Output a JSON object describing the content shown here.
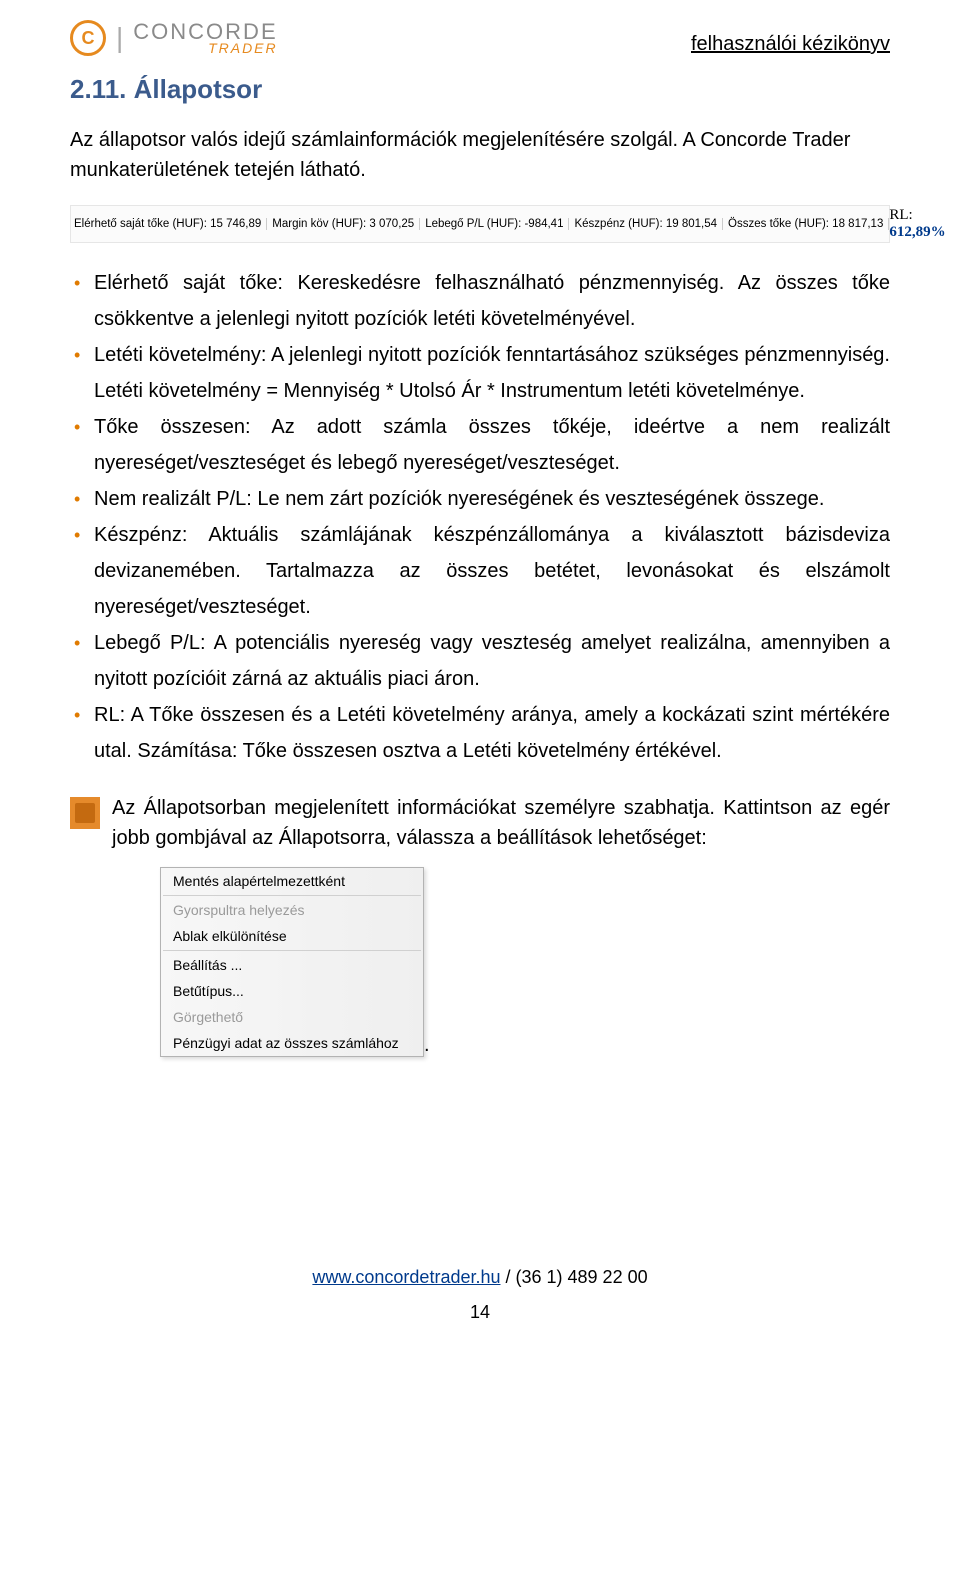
{
  "header": {
    "logo_letter": "C",
    "logo_main": "CONCORDE",
    "logo_sub": "TRADER",
    "right": "felhasználói kézikönyv"
  },
  "section_title": "2.11. Állapotsor",
  "intro": "Az állapotsor valós idejű számlainformációk megjelenítésére szolgál. A Concorde Trader munkaterületének tetején látható.",
  "statusbar": {
    "items": [
      "Elérhető saját tőke (HUF): 15 746,89",
      "Margin köv (HUF): 3 070,25",
      "Lebegő P/L (HUF): -984,41",
      "Készpénz (HUF): 19 801,54",
      "Összes tőke (HUF): 18 817,13"
    ],
    "rl_label": "RL: ",
    "rl_value": "612,89%"
  },
  "bullets": [
    "Elérhető saját tőke: Kereskedésre felhasználható pénzmennyiség. Az összes tőke csökkentve a jelenlegi nyitott pozíciók letéti követelményével.",
    "Letéti követelmény: A jelenlegi nyitott pozíciók fenntartásához szükséges pénzmennyiség. Letéti követelmény = Mennyiség * Utolsó Ár * Instrumentum letéti követelménye.",
    "Tőke összesen: Az adott számla összes tőkéje, ideértve a nem realizált nyereséget/veszteséget és lebegő nyereséget/veszteséget.",
    "Nem realizált P/L: Le nem zárt pozíciók nyereségének és veszteségének összege.",
    "Készpénz: Aktuális számlájának készpénzállománya a kiválasztott bázisdeviza devizanemében. Tartalmazza az összes betétet, levonásokat és elszámolt nyereséget/veszteséget.",
    "Lebegő P/L: A potenciális nyereség vagy veszteség amelyet realizálna, amennyiben a nyitott pozícióit zárná az aktuális piaci áron.",
    "RL: A Tőke összesen és a Letéti követelmény aránya, amely a kockázati szint mértékére utal. Számítása: Tőke összesen osztva a Letéti követelmény értékével."
  ],
  "note": "Az Állapotsorban megjelenített információkat személyre szabhatja. Kattintson az egér jobb gombjával az Állapotsorra, válassza a beállítások lehetőséget:",
  "context_menu": [
    {
      "label": "Mentés alapértelmezettként",
      "disabled": false
    },
    {
      "label": "Gyorspultra helyezés",
      "disabled": true
    },
    {
      "label": "Ablak elkülönítése",
      "disabled": false
    },
    {
      "label": "Beállítás ...",
      "disabled": false
    },
    {
      "label": "Betűtípus...",
      "disabled": false
    },
    {
      "label": "Görgethető",
      "disabled": true
    },
    {
      "label": "Pénzügyi adat az összes számlához",
      "disabled": false
    }
  ],
  "footer": {
    "link": "www.concordetrader.hu",
    "phone": " / (36 1) 489 22 00"
  },
  "page_number": "14"
}
